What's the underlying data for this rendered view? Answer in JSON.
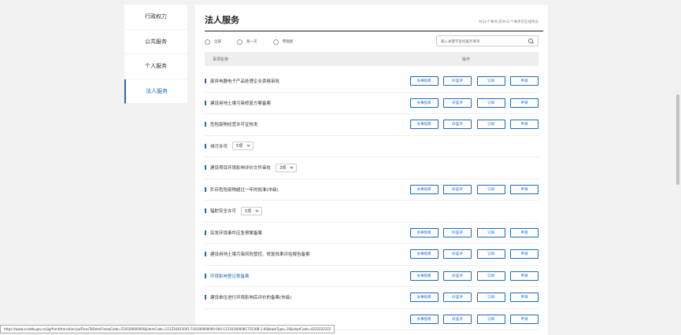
{
  "sidebar": {
    "items": [
      {
        "label": "行政权力"
      },
      {
        "label": "公共服务"
      },
      {
        "label": "个人服务"
      },
      {
        "label": "法人服务"
      }
    ]
  },
  "header": {
    "title": "法人服务",
    "summary": "共31个事项,其中31个事项可在线申办"
  },
  "filters": {
    "options": [
      "全部",
      "跑一次",
      "零跑腿"
    ]
  },
  "search": {
    "placeholder": "输入关键字查找服务事项"
  },
  "table": {
    "col_name": "事项名称",
    "col_ops": "操作"
  },
  "buttons": {
    "guide": "办事指南",
    "review": "好差评",
    "subscribe": "订阅",
    "apply": "申请"
  },
  "rows": [
    {
      "name": "废弃电器电子产品处理企业资格审批",
      "type": "ops"
    },
    {
      "name": "建设用地土壤污染修复方案备案",
      "type": "ops"
    },
    {
      "name": "危险废物经营许可证核发",
      "type": "ops"
    },
    {
      "name": "排污许可",
      "type": "dropdown",
      "dropdown": "5项"
    },
    {
      "name": "建设项目环境影响评价文件审批",
      "type": "dropdown",
      "dropdown": "3项"
    },
    {
      "name": "贮存危险废物超过一年的批准(市级)",
      "type": "ops"
    },
    {
      "name": "辐射安全许可",
      "type": "dropdown",
      "dropdown": "5项"
    },
    {
      "name": "突发环境事件应急预案备案",
      "type": "ops"
    },
    {
      "name": "建设用地土壤污染风险管控、修复效果评估报告备案",
      "type": "ops"
    },
    {
      "name": "环境影响登记表备案",
      "type": "ops",
      "link": true
    },
    {
      "name": "建设单位进行环境影响后评价的备案(市级)",
      "type": "ops"
    },
    {
      "name": "",
      "type": "ops"
    }
  ],
  "statusbar": {
    "url": "https://www.sczwfw.gov.cn/jiq/front/transition/ywTransToDetail?areaCode=510100000000&itemCode=511Z16015001-510100000000-000-11510100008172530B-1-00&taskType=10&deptCode=4222222222"
  }
}
